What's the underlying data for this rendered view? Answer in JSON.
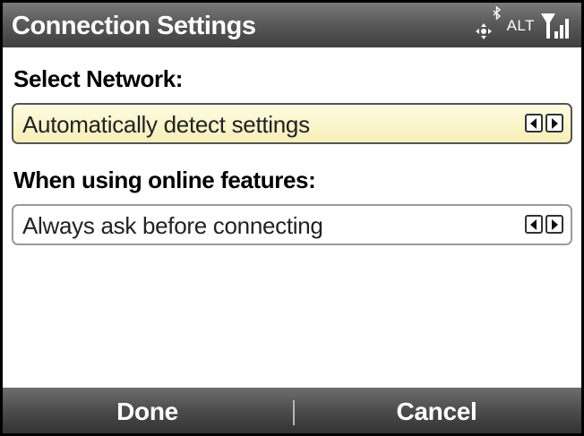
{
  "titlebar": {
    "title": "Connection Settings",
    "status": {
      "alt_text": "ALT",
      "icons": [
        "navigation-icon",
        "bluetooth-icon",
        "signal-strength-icon"
      ]
    }
  },
  "network": {
    "label": "Select Network:",
    "value": "Automatically detect settings",
    "focused": true
  },
  "online": {
    "label": "When using online features:",
    "value": "Always ask before connecting",
    "focused": false
  },
  "softkeys": {
    "left": "Done",
    "right": "Cancel"
  },
  "colors": {
    "focus_background": "#f6efb8",
    "bar_background": "#4c4c4c"
  }
}
